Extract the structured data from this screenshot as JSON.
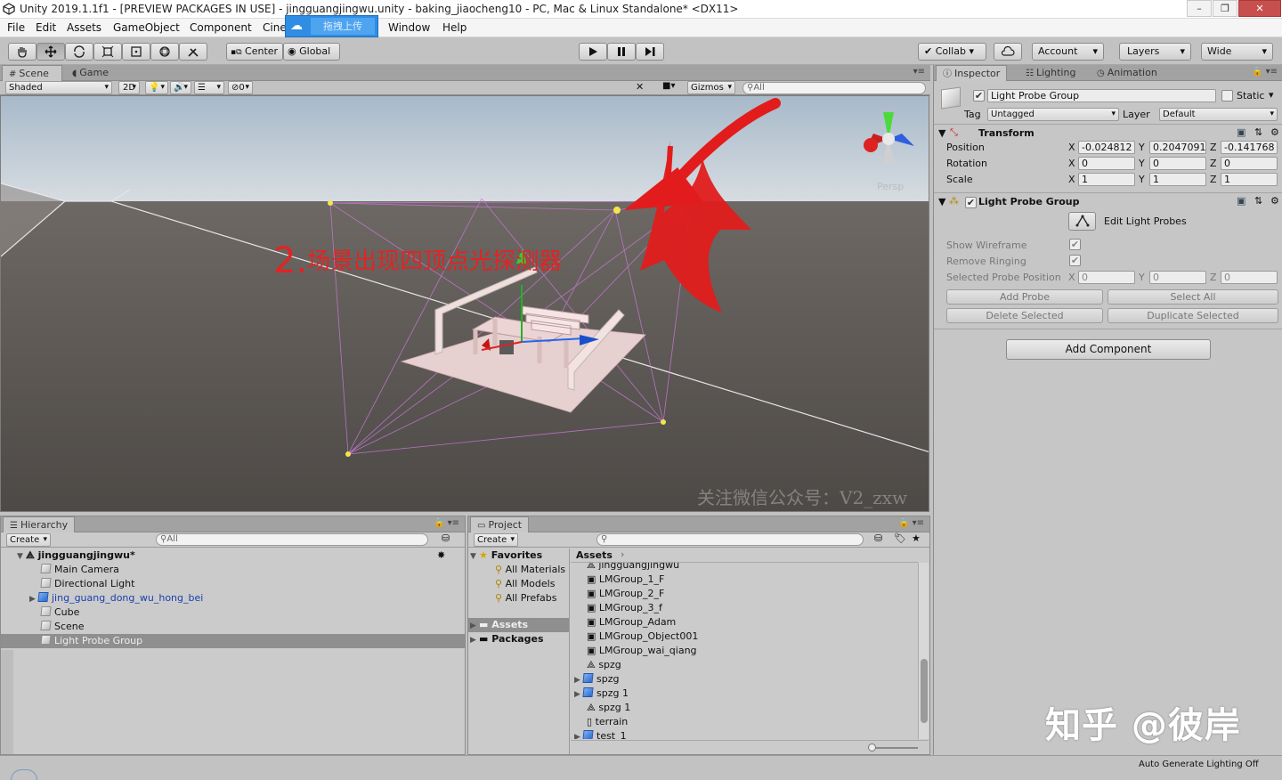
{
  "window": {
    "title": "Unity 2019.1.1f1 - [PREVIEW PACKAGES IN USE] - jingguangjingwu.unity - baking_jiaocheng10 - PC, Mac & Linux Standalone* <DX11>"
  },
  "menu": [
    "File",
    "Edit",
    "Assets",
    "GameObject",
    "Component",
    "Cine",
    "Window",
    "Help"
  ],
  "baidu": {
    "label": "拖拽上传"
  },
  "toolbar": {
    "pivot": "Center",
    "space": "Global",
    "collab": "Collab",
    "account": "Account",
    "layers": "Layers",
    "layout": "Wide"
  },
  "scene": {
    "tab_scene": "Scene",
    "tab_game": "Game",
    "shading": "Shaded",
    "mode2d": "2D",
    "effects_count": "0",
    "gizmos": "Gizmos",
    "search": "All",
    "persp": "Persp",
    "annotation_num": "2.",
    "annotation_text": "场景出现四顶点光探测器",
    "watermark": "关注微信公众号：V2_zxw"
  },
  "hierarchy": {
    "tab": "Hierarchy",
    "create": "Create",
    "search": "All",
    "scene_name": "jingguangjingwu*",
    "items": [
      "Main Camera",
      "Directional Light",
      "jing_guang_dong_wu_hong_bei",
      "Cube",
      "Scene",
      "Light Probe Group"
    ]
  },
  "project": {
    "tab": "Project",
    "create": "Create",
    "favorites": "Favorites",
    "fav_items": [
      "All Materials",
      "All Models",
      "All Prefabs"
    ],
    "assets": "Assets",
    "packages": "Packages",
    "breadcrumb": "Assets",
    "files": [
      "jingguangjingwu",
      "LMGroup_1_F",
      "LMGroup_2_F",
      "LMGroup_3_f",
      "LMGroup_Adam",
      "LMGroup_Object001",
      "LMGroup_wai_qiang",
      "spzg",
      "spzg",
      "spzg 1",
      "spzg 1",
      "terrain",
      "test_1"
    ]
  },
  "inspector": {
    "tab_inspector": "Inspector",
    "tab_lighting": "Lighting",
    "tab_animation": "Animation",
    "object_name": "Light Probe Group",
    "static": "Static",
    "tag_label": "Tag",
    "tag": "Untagged",
    "layer_label": "Layer",
    "layer": "Default",
    "transform": {
      "title": "Transform",
      "position_label": "Position",
      "rotation_label": "Rotation",
      "scale_label": "Scale",
      "position": {
        "x": "-0.024812",
        "y": "0.2047091",
        "z": "-0.141768"
      },
      "rotation": {
        "x": "0",
        "y": "0",
        "z": "0"
      },
      "scale": {
        "x": "1",
        "y": "1",
        "z": "1"
      }
    },
    "probe": {
      "title": "Light Probe Group",
      "edit": "Edit Light Probes",
      "show_wireframe": "Show Wireframe",
      "remove_ringing": "Remove Ringing",
      "selected_pos": "Selected Probe Position",
      "sx": "0",
      "sy": "0",
      "sz": "0",
      "add_probe": "Add Probe",
      "select_all": "Select All",
      "delete_selected": "Delete Selected",
      "duplicate_selected": "Duplicate Selected"
    },
    "add_component": "Add Component"
  },
  "axis": {
    "x": "X",
    "y": "Y",
    "z": "Z"
  },
  "watermark2": "知乎 @彼岸",
  "status": {
    "auto_lighting": "Auto Generate Lighting Off"
  },
  "colors": {
    "annotation": "#e32323",
    "probe_point": "#f4e64a",
    "probe_lines": "#c879d8",
    "selection": "#8f8f8f"
  }
}
